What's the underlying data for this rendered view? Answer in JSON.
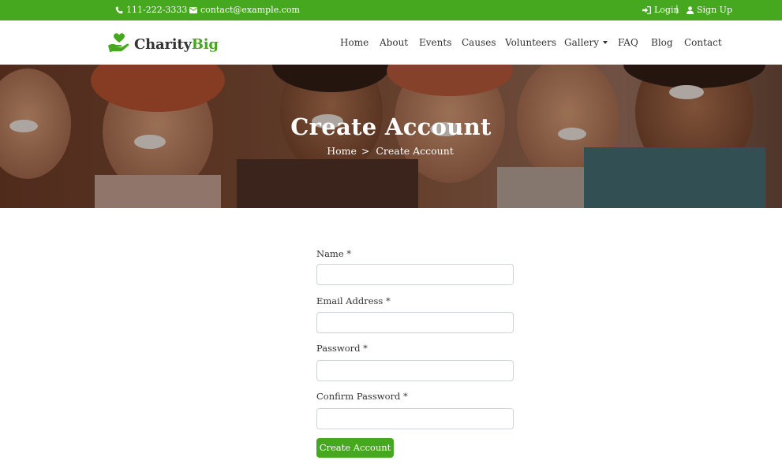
{
  "topbar": {
    "phone": "111-222-3333",
    "email": "contact@example.com",
    "login_label": "Login",
    "separator": "|",
    "signup_label": "Sign Up",
    "background": "#46a81f"
  },
  "brand": {
    "name_primary": "Charity",
    "name_accent": "Big",
    "accent_color": "#46a81f"
  },
  "nav": {
    "items": [
      {
        "label": "Home"
      },
      {
        "label": "About"
      },
      {
        "label": "Events"
      },
      {
        "label": "Causes"
      },
      {
        "label": "Volunteers"
      },
      {
        "label": "Gallery",
        "has_dropdown": true
      },
      {
        "label": "FAQ"
      },
      {
        "label": "Blog"
      },
      {
        "label": "Contact"
      }
    ]
  },
  "hero": {
    "title": "Create Account",
    "breadcrumb": {
      "home": "Home",
      "separator": ">",
      "current": "Create Account"
    }
  },
  "form": {
    "fields": [
      {
        "label": "Name *",
        "value": ""
      },
      {
        "label": "Email Address *",
        "value": ""
      },
      {
        "label": "Password *",
        "value": ""
      },
      {
        "label": "Confirm Password *",
        "value": ""
      }
    ],
    "submit_label": "Create Account"
  }
}
